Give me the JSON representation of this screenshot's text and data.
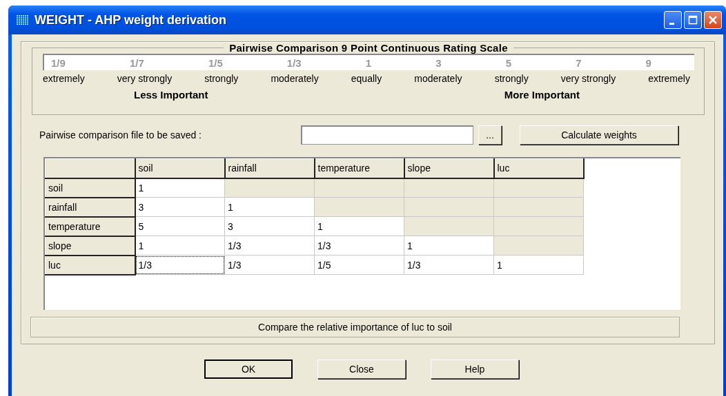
{
  "window": {
    "title": "WEIGHT - AHP weight derivation"
  },
  "scale": {
    "title": "Pairwise Comparison 9 Point Continuous Rating Scale",
    "points": [
      {
        "value": "1/9",
        "label": "extremely"
      },
      {
        "value": "1/7",
        "label": "very strongly"
      },
      {
        "value": "1/5",
        "label": "strongly"
      },
      {
        "value": "1/3",
        "label": "moderately"
      },
      {
        "value": "1",
        "label": "equally"
      },
      {
        "value": "3",
        "label": "moderately"
      },
      {
        "value": "5",
        "label": "strongly"
      },
      {
        "value": "7",
        "label": "very strongly"
      },
      {
        "value": "9",
        "label": "extremely"
      }
    ],
    "less_label": "Less Important",
    "more_label": "More Important"
  },
  "file": {
    "label": "Pairwise comparison file to be saved :",
    "browse": "...",
    "calculate": "Calculate weights"
  },
  "table": {
    "columns": [
      "soil",
      "rainfall",
      "temperature",
      "slope",
      "luc"
    ],
    "rows": [
      {
        "name": "soil",
        "cells": [
          {
            "value": "1",
            "editable": true,
            "selected": false
          },
          {
            "editable": false,
            "selected": false
          },
          {
            "editable": false,
            "selected": false
          },
          {
            "editable": false,
            "selected": false
          },
          {
            "editable": false,
            "selected": false
          }
        ]
      },
      {
        "name": "rainfall",
        "cells": [
          {
            "value": "3",
            "editable": true,
            "selected": false
          },
          {
            "value": "1",
            "editable": true,
            "selected": false
          },
          {
            "editable": false,
            "selected": false
          },
          {
            "editable": false,
            "selected": false
          },
          {
            "editable": false,
            "selected": false
          }
        ]
      },
      {
        "name": "temperature",
        "cells": [
          {
            "value": "5",
            "editable": true,
            "selected": false
          },
          {
            "value": "3",
            "editable": true,
            "selected": false
          },
          {
            "value": "1",
            "editable": true,
            "selected": false
          },
          {
            "editable": false,
            "selected": false
          },
          {
            "editable": false,
            "selected": false
          }
        ]
      },
      {
        "name": "slope",
        "cells": [
          {
            "value": "1",
            "editable": true,
            "selected": false
          },
          {
            "value": "1/3",
            "editable": true,
            "selected": false
          },
          {
            "value": "1/3",
            "editable": true,
            "selected": false
          },
          {
            "value": "1",
            "editable": true,
            "selected": false
          },
          {
            "editable": false,
            "selected": false
          }
        ]
      },
      {
        "name": "luc",
        "cells": [
          {
            "value": "1/3",
            "editable": true,
            "selected": true
          },
          {
            "value": "1/3",
            "editable": true,
            "selected": false
          },
          {
            "value": "1/5",
            "editable": true,
            "selected": false
          },
          {
            "value": "1/3",
            "editable": true,
            "selected": false
          },
          {
            "value": "1",
            "editable": true,
            "selected": false
          }
        ]
      }
    ]
  },
  "status": "Compare the relative importance of luc to soil",
  "buttons": [
    {
      "label": "OK",
      "default": true
    },
    {
      "label": "Close",
      "default": false
    },
    {
      "label": "Help",
      "default": false
    }
  ]
}
